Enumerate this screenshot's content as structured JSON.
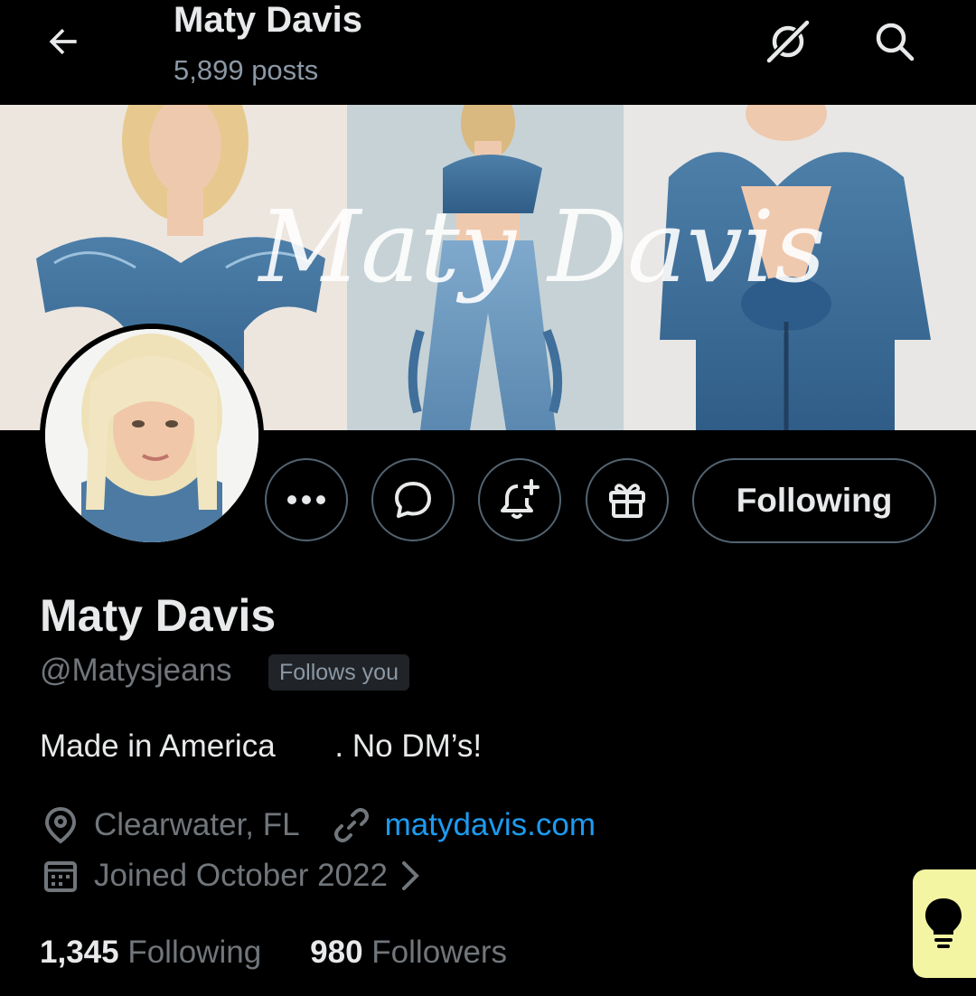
{
  "topbar": {
    "title": "Maty Davis",
    "post_count": "5,899 posts",
    "back_icon": "arrow-left-icon",
    "grok_icon": "grok-icon",
    "search_icon": "search-icon"
  },
  "banner": {
    "watermark_text": "Maty Davis"
  },
  "actions": {
    "more_icon": "more-horizontal-icon",
    "message_icon": "message-bubble-icon",
    "notify_icon": "bell-plus-icon",
    "gift_icon": "gift-icon",
    "follow_label": "Following"
  },
  "profile": {
    "name": "Maty Davis",
    "handle": "@Matysjeans",
    "follows_you": "Follows you",
    "bio_before_flag": "Made in America ",
    "bio_after_flag": ". No DM’s!",
    "location": "Clearwater, FL",
    "website": "matydavis.com",
    "joined": "Joined October 2022"
  },
  "stats": {
    "following_count": "1,345",
    "following_label": " Following",
    "followers_count": "980",
    "followers_label": " Followers"
  },
  "colors": {
    "background": "#000000",
    "text": "#e7e9ea",
    "muted": "#71767b",
    "link": "#1d9bf0",
    "fab": "#f3f5a3"
  }
}
